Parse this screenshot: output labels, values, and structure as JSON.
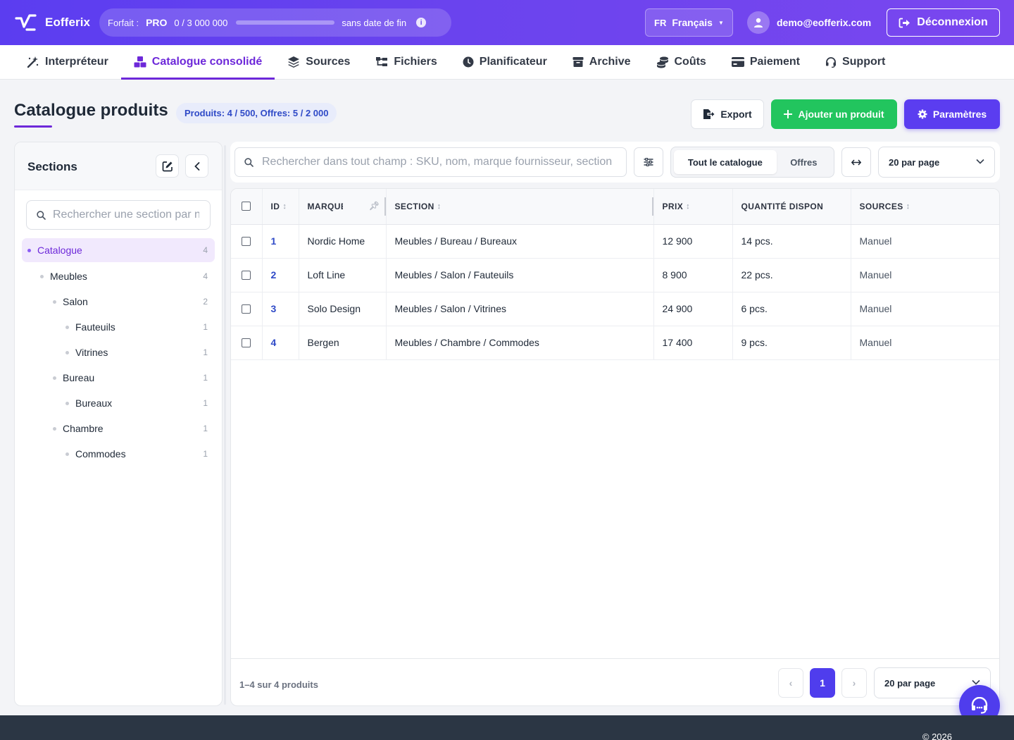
{
  "header": {
    "brand": "Eofferix",
    "plan": {
      "label": "Forfait :",
      "name": "PRO",
      "usage": "0 / 3 000 000",
      "progress_fraction": 0,
      "expiry": "sans date de fin"
    },
    "language": {
      "code": "FR",
      "name": "Français"
    },
    "user_email": "demo@eofferix.com",
    "logout_label": "Déconnexion"
  },
  "nav": {
    "items": [
      {
        "label": "Interpréteur",
        "icon": "magic-wand-icon",
        "active": false
      },
      {
        "label": "Catalogue consolidé",
        "icon": "cubes-icon",
        "active": true
      },
      {
        "label": "Sources",
        "icon": "layers-icon",
        "active": false
      },
      {
        "label": "Fichiers",
        "icon": "folder-tree-icon",
        "active": false
      },
      {
        "label": "Planificateur",
        "icon": "clock-icon",
        "active": false
      },
      {
        "label": "Archive",
        "icon": "archive-box-icon",
        "active": false
      },
      {
        "label": "Coûts",
        "icon": "coins-icon",
        "active": false
      },
      {
        "label": "Paiement",
        "icon": "credit-card-icon",
        "active": false
      },
      {
        "label": "Support",
        "icon": "headset-icon",
        "active": false
      }
    ]
  },
  "page": {
    "title": "Catalogue produits",
    "count_badge": "Produits: 4 / 500, Offres: 5 / 2 000",
    "export_label": "Export",
    "add_label": "Ajouter un produit",
    "params_label": "Paramètres"
  },
  "sidebar": {
    "title": "Sections",
    "search_placeholder": "Rechercher une section par nom",
    "tree": [
      {
        "label": "Catalogue",
        "count": "4",
        "depth": 0,
        "active": true
      },
      {
        "label": "Meubles",
        "count": "4",
        "depth": 1,
        "active": false
      },
      {
        "label": "Salon",
        "count": "2",
        "depth": 2,
        "active": false
      },
      {
        "label": "Fauteuils",
        "count": "1",
        "depth": 3,
        "active": false
      },
      {
        "label": "Vitrines",
        "count": "1",
        "depth": 3,
        "active": false
      },
      {
        "label": "Bureau",
        "count": "1",
        "depth": 2,
        "active": false
      },
      {
        "label": "Bureaux",
        "count": "1",
        "depth": 3,
        "active": false
      },
      {
        "label": "Chambre",
        "count": "1",
        "depth": 2,
        "active": false
      },
      {
        "label": "Commodes",
        "count": "1",
        "depth": 3,
        "active": false
      }
    ]
  },
  "toolbar": {
    "search_placeholder": "Rechercher dans tout champ : SKU, nom, marque fournisseur, section",
    "segment_all": "Tout le catalogue",
    "segment_offers": "Offres",
    "per_page": "20 par page"
  },
  "table": {
    "headers": {
      "id": "ID",
      "brand": "MARQUE",
      "section": "SECTION",
      "price": "PRIX",
      "qty": "QUANTITÉ DISPONIBLE",
      "sources": "SOURCES"
    },
    "rows": [
      {
        "id": "1",
        "brand": "Nordic Home",
        "section": "Meubles / Bureau / Bureaux",
        "price": "12 900",
        "qty": "14 pcs.",
        "sources": "Manuel"
      },
      {
        "id": "2",
        "brand": "Loft Line",
        "section": "Meubles / Salon / Fauteuils",
        "price": "8 900",
        "qty": "22 pcs.",
        "sources": "Manuel"
      },
      {
        "id": "3",
        "brand": "Solo Design",
        "section": "Meubles / Salon / Vitrines",
        "price": "24 900",
        "qty": "6 pcs.",
        "sources": "Manuel"
      },
      {
        "id": "4",
        "brand": "Bergen",
        "section": "Meubles / Chambre / Commodes",
        "price": "17 400",
        "qty": "9 pcs.",
        "sources": "Manuel"
      }
    ],
    "range_text": "1–4 sur 4 produits",
    "current_page": "1",
    "prev_label": "‹",
    "next_label": "›",
    "per_page": "20 par page"
  },
  "footer": {
    "copyright": "© 2026"
  },
  "colors": {
    "brand_gradient_start": "#5b3df0",
    "accent_purple": "#6d28d9",
    "success_green": "#22c55e",
    "primary_indigo": "#4f3ded",
    "badge_text": "#2f4ac7",
    "footer_bg": "#2b3644"
  }
}
